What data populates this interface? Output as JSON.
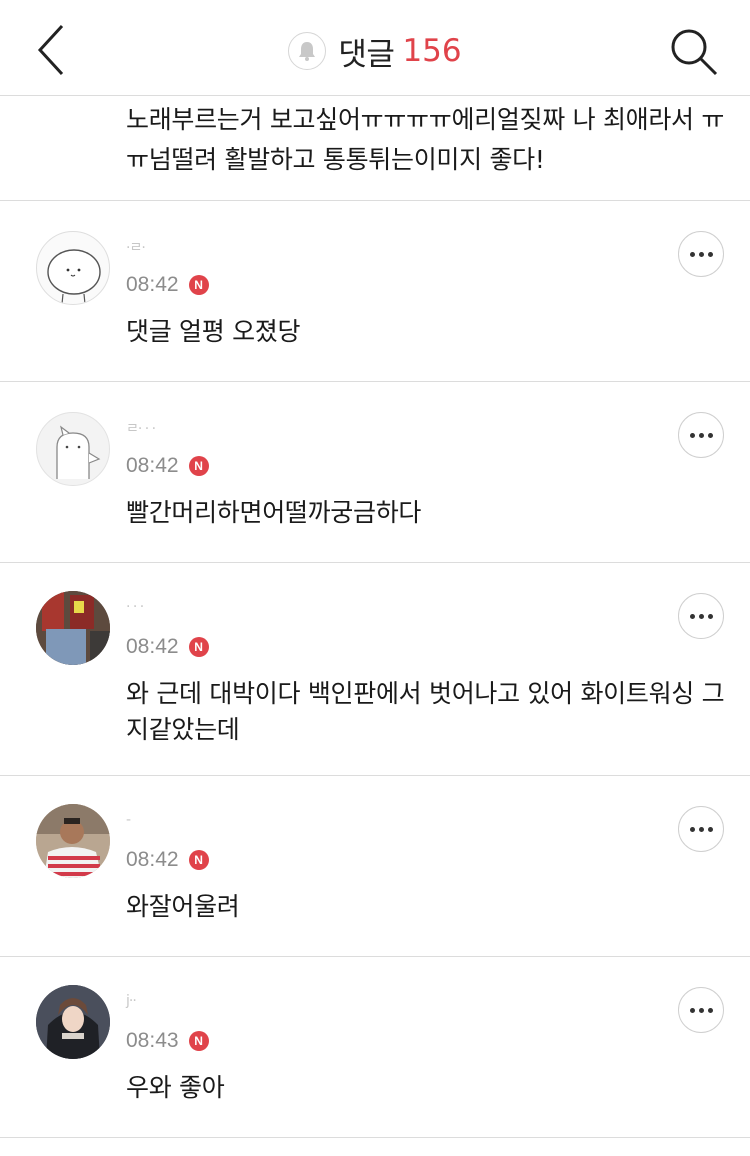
{
  "header": {
    "title": "댓글",
    "count": "156",
    "back_icon": "chevron-left-icon",
    "bell_icon": "bell-icon",
    "search_icon": "search-icon",
    "accent_color": "#e0434a"
  },
  "top_comment": {
    "text": "노래부르는거 보고싶어ㅠㅠㅠㅠ에리얼짖짜 나 최애라서 ㅠㅠ넘떨려 활발하고 통통튀는이미지 좋다!"
  },
  "comments": [
    {
      "username": "·ㄹ·",
      "time": "08:42",
      "badge": "N",
      "text": "댓글 얼평 오졌당"
    },
    {
      "username": "ㄹ· · ·",
      "time": "08:42",
      "badge": "N",
      "text": "빨간머리하면어떨까궁금하다"
    },
    {
      "username": "· · ·",
      "time": "08:42",
      "badge": "N",
      "text": "와 근데 대박이다 백인판에서 벗어나고 있어 화이트워싱 그지같았는데"
    },
    {
      "username": "-",
      "time": "08:42",
      "badge": "N",
      "text": "와잘어울려"
    },
    {
      "username": "j··",
      "time": "08:43",
      "badge": "N",
      "text": "우와 좋아"
    }
  ]
}
